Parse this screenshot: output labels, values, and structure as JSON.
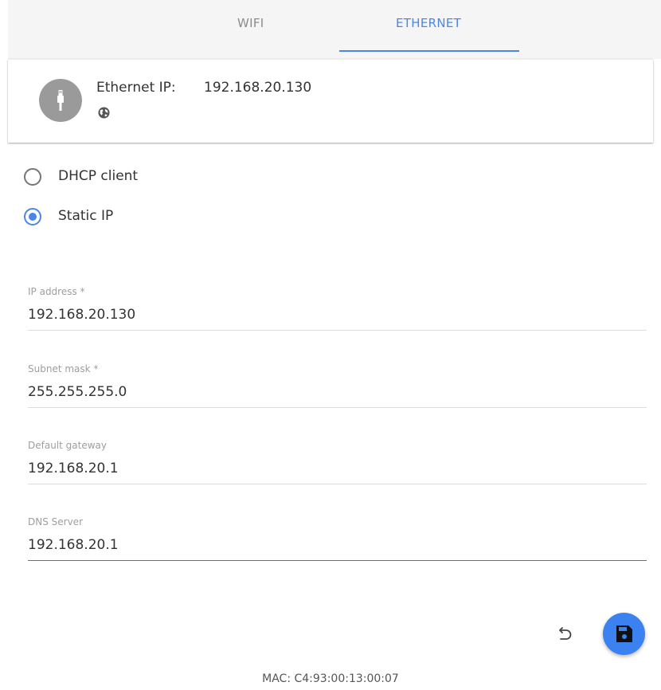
{
  "tabs": [
    {
      "label": "WIFI",
      "active": false
    },
    {
      "label": "ETHERNET",
      "active": true
    }
  ],
  "info": {
    "label": "Ethernet IP:",
    "ip": "192.168.20.130",
    "icon": "ethernet-plug-icon",
    "status_icon": "globe-icon"
  },
  "mode": {
    "options": [
      {
        "label": "DHCP client",
        "checked": false
      },
      {
        "label": "Static IP",
        "checked": true
      }
    ]
  },
  "fields": {
    "ip_address": {
      "label": "IP address *",
      "value": "192.168.20.130"
    },
    "subnet_mask": {
      "label": "Subnet mask *",
      "value": "255.255.255.0"
    },
    "default_gateway": {
      "label": "Default gateway",
      "value": "192.168.20.1"
    },
    "dns_server": {
      "label": "DNS Server",
      "value": "192.168.20.1"
    }
  },
  "actions": {
    "undo_icon": "undo-icon",
    "save_icon": "floppy-disk-icon"
  },
  "mac": "MAC: C4:93:00:13:00:07",
  "colors": {
    "accent": "#4a86e8",
    "save_button": "#3b82f0",
    "avatar": "#9a9a9a",
    "tab_bar": "#f5f5f5"
  }
}
